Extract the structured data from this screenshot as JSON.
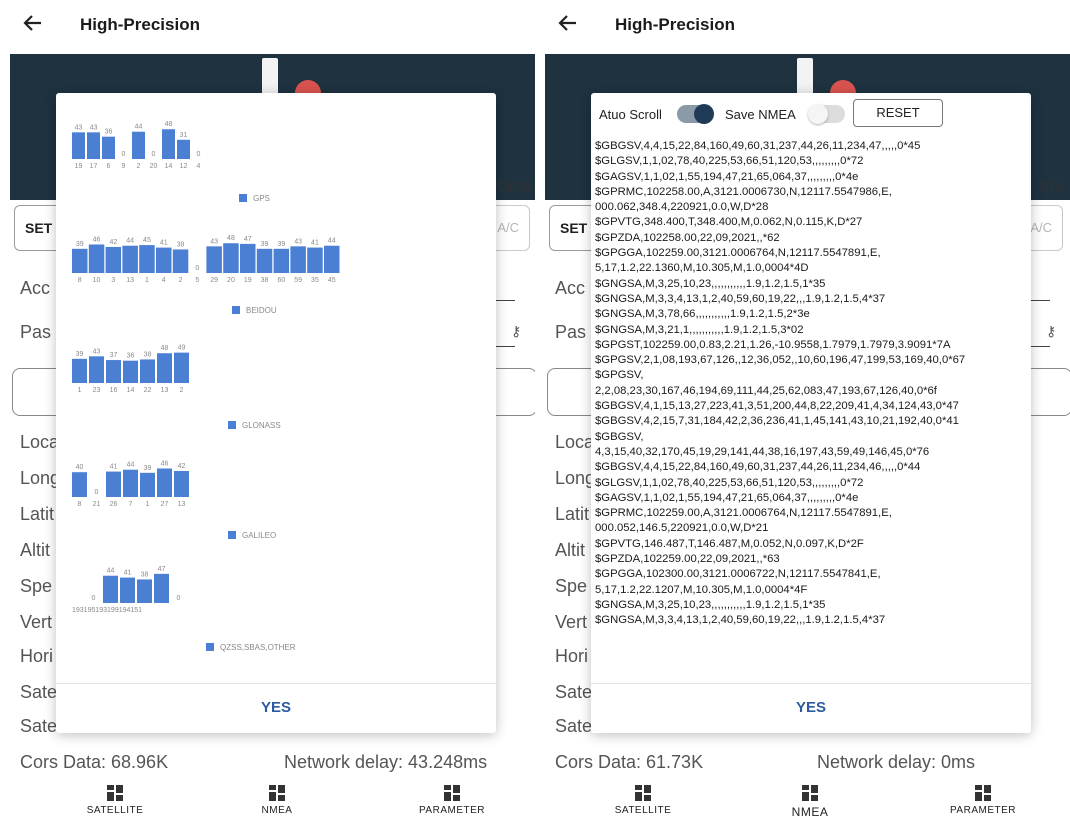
{
  "left": {
    "title": "High-Precision",
    "gnss_label": "Gnss",
    "set_label": "SET",
    "ac_label": "T A/C",
    "acc_label": "Acc",
    "pass_label": "Pas",
    "bg_labels": [
      "Loca",
      "Long",
      "Latit",
      "Altit",
      "Spe",
      "Vert",
      "Hori",
      "Sate",
      "Sate"
    ],
    "cors_data": "Cors Data:  68.96K",
    "network_delay": "Network delay:  43.248ms",
    "nav": [
      {
        "label": "SATELLITE"
      },
      {
        "label": "NMEA"
      },
      {
        "label": "PARAMETER"
      }
    ],
    "dialog_yes": "YES",
    "chart_data": {
      "type": "bar",
      "groups": [
        {
          "name": "GPS",
          "color": "#4a7fd4",
          "values": [
            43,
            43,
            36,
            0,
            44,
            0,
            48,
            31,
            0
          ],
          "ids": [
            "19",
            "17",
            "6",
            "9",
            "2",
            "20",
            "14",
            "12",
            "4"
          ]
        },
        {
          "name": "BEIDOU",
          "color": "#4a7fd4",
          "values": [
            39,
            46,
            42,
            44,
            45,
            41,
            38,
            0,
            43,
            48,
            47,
            39,
            39,
            43,
            41,
            44
          ],
          "ids": [
            "8",
            "10",
            "3",
            "13",
            "1",
            "4",
            "2",
            "5",
            "29",
            "20",
            "19",
            "38",
            "60",
            "59",
            "35",
            "45"
          ]
        },
        {
          "name": "GLONASS",
          "color": "#4a7fd4",
          "values": [
            39,
            43,
            37,
            36,
            38,
            48,
            49
          ],
          "ids": [
            "1",
            "23",
            "16",
            "14",
            "22",
            "13",
            "2"
          ]
        },
        {
          "name": "GALILEO",
          "color": "#4a7fd4",
          "values": [
            40,
            0,
            41,
            44,
            39,
            46,
            42
          ],
          "ids": [
            "8",
            "21",
            "26",
            "7",
            "1",
            "27",
            "13"
          ]
        },
        {
          "name": "QZSS,SBAS,OTHER",
          "color": "#4a7fd4",
          "values": [
            0,
            44,
            41,
            38,
            47,
            0
          ],
          "ids_text": "193195193199194151"
        }
      ]
    }
  },
  "right": {
    "title": "High-Precision",
    "gnss_label": "Gns",
    "set_label": "SET",
    "ac_label": "T A/C",
    "acc_label": "Acc",
    "pass_label": "Pas",
    "bg_labels": [
      "Loca",
      "Long",
      "Latit",
      "Altit",
      "Spe",
      "Vert",
      "Hori",
      "Sate",
      "Sate"
    ],
    "cors_data": "Cors Data:  61.73K",
    "network_delay": "Network delay:  0ms",
    "nav": [
      {
        "label": "SATELLITE"
      },
      {
        "label": "NMEA"
      },
      {
        "label": "PARAMETER"
      }
    ],
    "auto_scroll_label": "Atuo Scroll",
    "auto_scroll_on": true,
    "save_nmea_label": "Save NMEA",
    "save_nmea_on": false,
    "reset_label": "RESET",
    "dialog_yes": "YES",
    "nmea_lines": [
      "$GBGSV,4,4,15,22,84,160,49,60,31,237,44,26,11,234,47,,,,,0*45",
      "$GLGSV,1,1,02,78,40,225,53,66,51,120,53,,,,,,,,,0*72",
      "$GAGSV,1,1,02,1,55,194,47,21,65,064,37,,,,,,,,,0*4e",
      "$GPRMC,102258.00,A,3121.0006730,N,12117.5547986,E,",
      "000.062,348.4,220921,0.0,W,D*28",
      "$GPVTG,348.400,T,348.400,M,0.062,N,0.115,K,D*27",
      "$GPZDA,102258.00,22,09,2021,,*62",
      "$GPGGA,102259.00,3121.0006764,N,12117.5547891,E,",
      "5,17,1.2,22.1360,M,10.305,M,1.0,0004*4D",
      "$GNGSA,M,3,25,10,23,,,,,,,,,,,1.9,1.2,1.5,1*35",
      "$GNGSA,M,3,3,4,13,1,2,40,59,60,19,22,,,1.9,1.2,1.5,4*37",
      "$GNGSA,M,3,78,66,,,,,,,,,,,1.9,1.2,1.5,2*3e",
      "$GNGSA,M,3,21,1,,,,,,,,,,,1.9,1.2,1.5,3*02",
      "$GPGST,102259.00,0.83,2.21,1.26,-10.9558,1.7979,1.7979,3.9091*7A",
      "$GPGSV,2,1,08,193,67,126,,12,36,052,,10,60,196,47,199,53,169,40,0*67",
      "$GPGSV,",
      "2,2,08,23,30,167,46,194,69,111,44,25,62,083,47,193,67,126,40,0*6f",
      "$GBGSV,4,1,15,13,27,223,41,3,51,200,44,8,22,209,41,4,34,124,43,0*47",
      "$GBGSV,4,2,15,7,31,184,42,2,36,236,41,1,45,141,43,10,21,192,40,0*41",
      "$GBGSV,",
      "4,3,15,40,32,170,45,19,29,141,44,38,16,197,43,59,49,146,45,0*76",
      "$GBGSV,4,4,15,22,84,160,49,60,31,237,44,26,11,234,46,,,,,0*44",
      "$GLGSV,1,1,02,78,40,225,53,66,51,120,53,,,,,,,,,0*72",
      "$GAGSV,1,1,02,1,55,194,47,21,65,064,37,,,,,,,,,0*4e",
      "$GPRMC,102259.00,A,3121.0006764,N,12117.5547891,E,",
      "000.052,146.5,220921,0.0,W,D*21",
      "$GPVTG,146.487,T,146.487,M,0.052,N,0.097,K,D*2F",
      "$GPZDA,102259.00,22,09,2021,,*63",
      "$GPGGA,102300.00,3121.0006722,N,12117.5547841,E,",
      "5,17,1.2,22.1207,M,10.305,M,1.0,0004*4F",
      "$GNGSA,M,3,25,10,23,,,,,,,,,,,1.9,1.2,1.5,1*35",
      "$GNGSA,M,3,3,4,13,1,2,40,59,60,19,22,,,1.9,1.2,1.5,4*37"
    ]
  }
}
